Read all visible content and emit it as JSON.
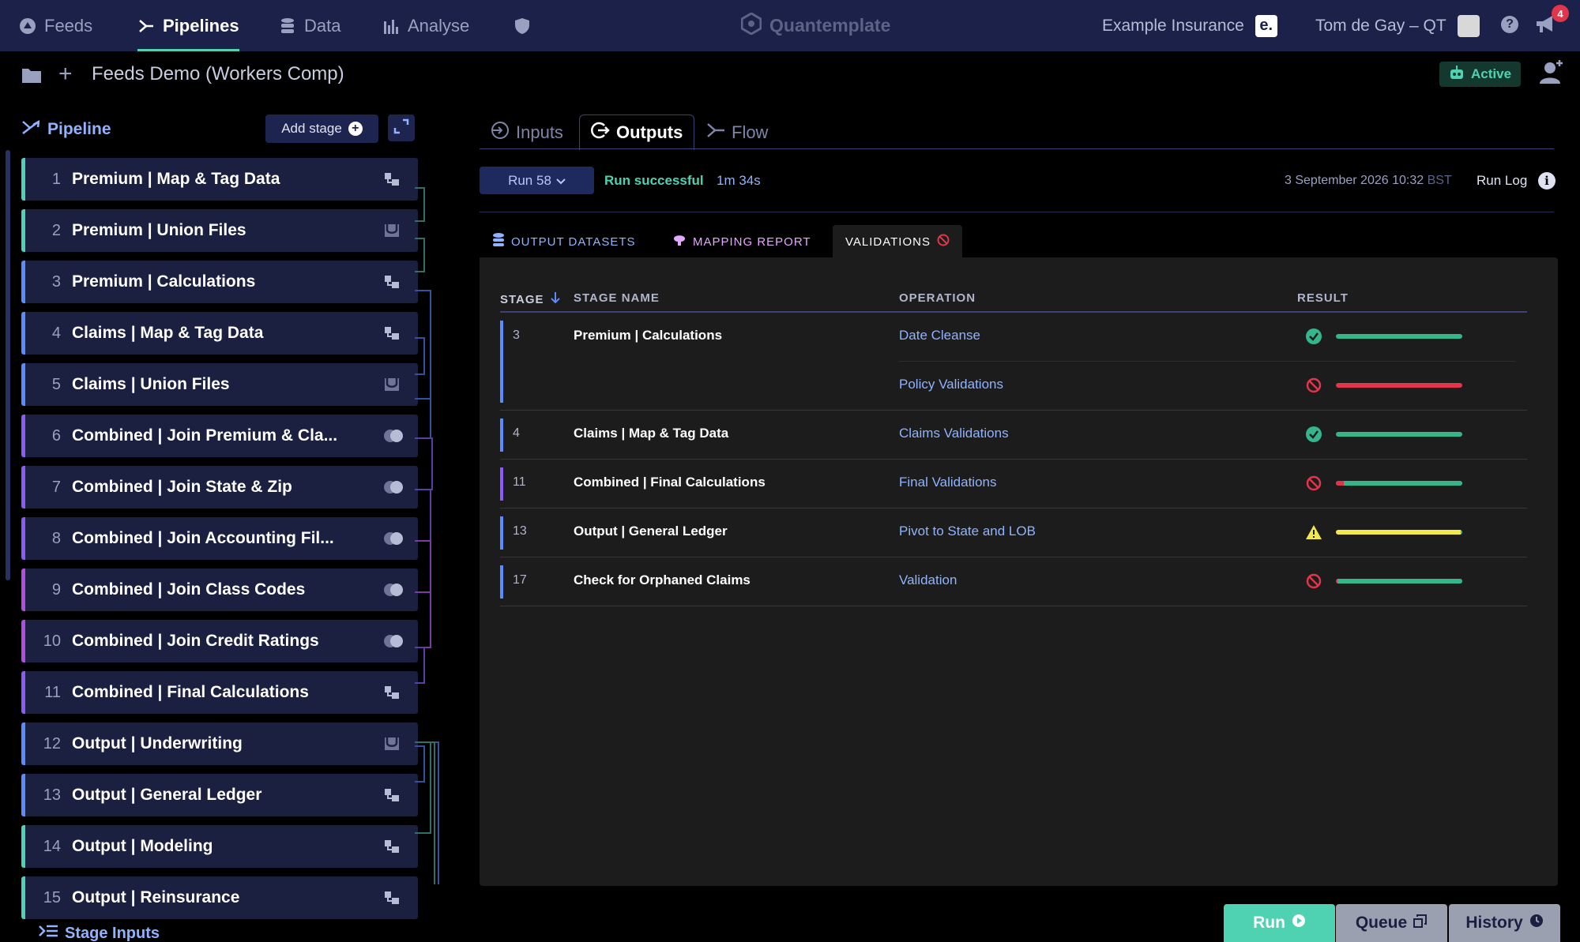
{
  "nav": {
    "items": [
      {
        "label": "Feeds",
        "icon": "feeds-icon"
      },
      {
        "label": "Pipelines",
        "icon": "pipelines-icon"
      },
      {
        "label": "Data",
        "icon": "database-icon"
      },
      {
        "label": "Analyse",
        "icon": "bar-chart-icon"
      }
    ],
    "active": "Pipelines",
    "brand": "Quantemplate",
    "org_name": "Example Insurance",
    "org_badge": "e.",
    "user_name": "Tom de Gay – QT",
    "help": "?",
    "notification_count": "4"
  },
  "project": {
    "title": "Feeds Demo (Workers Comp)",
    "status": "Active"
  },
  "pipeline": {
    "heading": "Pipeline",
    "add_stage_label": "Add stage",
    "stages": [
      {
        "num": "1",
        "name": "Premium | Map & Tag Data",
        "icon": "map-tag-icon",
        "accent": "#4fd2b1"
      },
      {
        "num": "2",
        "name": "Premium | Union Files",
        "icon": "union-icon",
        "accent": "#4fd2b1"
      },
      {
        "num": "3",
        "name": "Premium | Calculations",
        "icon": "calculation-icon",
        "accent": "#5b8cff"
      },
      {
        "num": "4",
        "name": "Claims | Map & Tag Data",
        "icon": "map-tag-icon",
        "accent": "#5b8cff"
      },
      {
        "num": "5",
        "name": "Claims | Union Files",
        "icon": "union-icon",
        "accent": "#5b8cff"
      },
      {
        "num": "6",
        "name": "Combined | Join Premium & Cla...",
        "icon": "join-icon",
        "accent": "#8a5cf5"
      },
      {
        "num": "7",
        "name": "Combined | Join State & Zip",
        "icon": "join-icon",
        "accent": "#8a5cf5"
      },
      {
        "num": "8",
        "name": "Combined | Join Accounting Fil...",
        "icon": "join-icon",
        "accent": "#8a5cf5"
      },
      {
        "num": "9",
        "name": "Combined | Join Class Codes",
        "icon": "join-icon",
        "accent": "#b04ee0"
      },
      {
        "num": "10",
        "name": "Combined | Join Credit Ratings",
        "icon": "join-icon",
        "accent": "#b04ee0"
      },
      {
        "num": "11",
        "name": "Combined | Final Calculations",
        "icon": "calculation-icon",
        "accent": "#8a5cf5"
      },
      {
        "num": "12",
        "name": "Output | Underwriting",
        "icon": "union-icon",
        "accent": "#5b8cff"
      },
      {
        "num": "13",
        "name": "Output | General Ledger",
        "icon": "calculation-icon",
        "accent": "#5b8cff"
      },
      {
        "num": "14",
        "name": "Output | Modeling",
        "icon": "calculation-icon",
        "accent": "#4fd2b1"
      },
      {
        "num": "15",
        "name": "Output | Reinsurance",
        "icon": "calculation-icon",
        "accent": "#4fd2b1"
      }
    ],
    "stage_inputs_label": "Stage Inputs"
  },
  "tabs": {
    "inputs": "Inputs",
    "outputs": "Outputs",
    "flow": "Flow"
  },
  "run": {
    "label": "Run 58",
    "status": "Run successful",
    "duration": "1m 34s",
    "date": "3 September 2026 10:32",
    "timezone": "BST",
    "log_label": "Run Log"
  },
  "subtabs": {
    "output_datasets": "OUTPUT DATASETS",
    "mapping_report": "MAPPING REPORT",
    "validations": "VALIDATIONS"
  },
  "validations": {
    "headers": {
      "stage": "STAGE",
      "stage_name": "STAGE NAME",
      "operation": "OPERATION",
      "result": "RESULT"
    },
    "rows": [
      {
        "stage": "3",
        "name": "Premium | Calculations",
        "operation": "Date Cleanse",
        "status": "pass",
        "fail_fraction": 0.0,
        "warn_fraction": 0.0
      },
      {
        "stage": "",
        "name": "",
        "operation": "Policy Validations",
        "status": "fail",
        "fail_fraction": 1.0,
        "warn_fraction": 0.0
      },
      {
        "stage": "4",
        "name": "Claims | Map & Tag Data",
        "operation": "Claims Validations",
        "status": "pass",
        "fail_fraction": 0.0,
        "warn_fraction": 0.0
      },
      {
        "stage": "11",
        "name": "Combined | Final Calculations",
        "operation": "Final Validations",
        "status": "fail",
        "fail_fraction": 0.06,
        "warn_fraction": 0.0
      },
      {
        "stage": "13",
        "name": "Output | General Ledger",
        "operation": "Pivot to State and LOB",
        "status": "warning",
        "fail_fraction": 0.0,
        "warn_fraction": 0.99
      },
      {
        "stage": "17",
        "name": "Check for Orphaned Claims",
        "operation": "Validation",
        "status": "fail",
        "fail_fraction": 0.01,
        "warn_fraction": 0.0
      }
    ]
  },
  "actions": {
    "run": "Run",
    "queue": "Queue",
    "history": "History"
  },
  "colors": {
    "nav_bg": "#1b2148",
    "accent": "#4fd2b1",
    "pass": "#35b58c",
    "fail": "#e0354b",
    "warn": "#f2e74b",
    "link": "#8fb3ff"
  }
}
